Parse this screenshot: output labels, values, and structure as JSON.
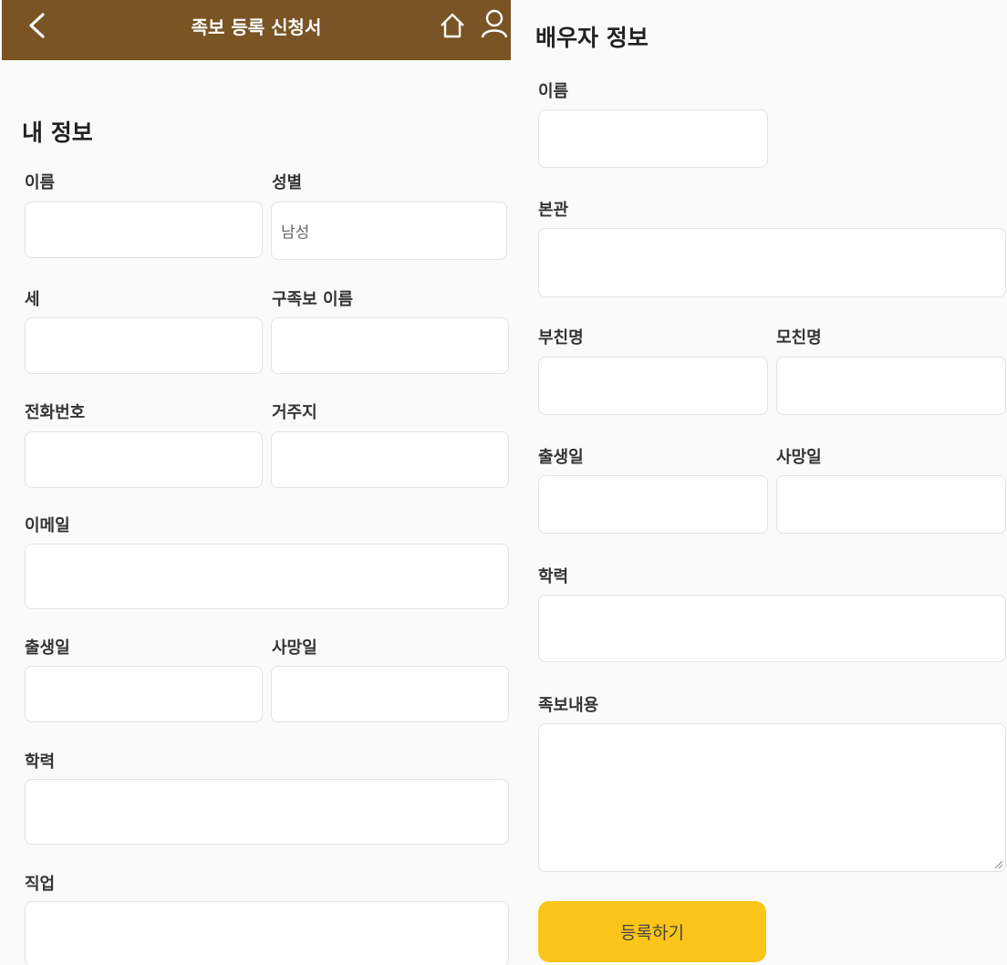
{
  "header": {
    "title": "족보 등록 신청서",
    "bg_color": "#7a5424"
  },
  "my_info": {
    "title": "내 정보",
    "name_label": "이름",
    "gender_label": "성별",
    "gender_value": "남성",
    "generation_label": "세",
    "old_genealogy_name_label": "구족보 이름",
    "phone_label": "전화번호",
    "residence_label": "거주지",
    "email_label": "이메일",
    "birth_date_label": "출생일",
    "death_date_label": "사망일",
    "education_label": "학력",
    "occupation_label": "직업"
  },
  "spouse_info": {
    "title": "배우자 정보",
    "name_label": "이름",
    "origin_label": "본관",
    "father_name_label": "부친명",
    "mother_name_label": "모친명",
    "birth_date_label": "출생일",
    "death_date_label": "사망일",
    "education_label": "학력",
    "genealogy_content_label": "족보내용"
  },
  "submit": {
    "label": "등록하기",
    "color": "#fbc519"
  }
}
